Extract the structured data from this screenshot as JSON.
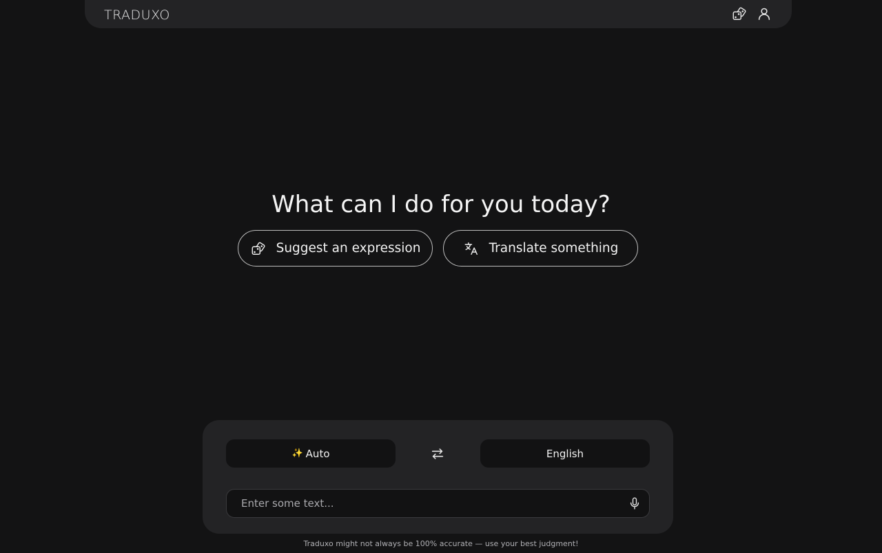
{
  "header": {
    "logo": "TRADUXO",
    "icons": [
      "dice-icon",
      "user-icon"
    ]
  },
  "main": {
    "headline": "What can I do for you today?",
    "actions": [
      {
        "label": "Suggest an expression",
        "icon": "dice-icon"
      },
      {
        "label": "Translate something",
        "icon": "translate-icon"
      }
    ]
  },
  "translator": {
    "source_language": "Auto",
    "source_icon": "✨",
    "target_language": "English",
    "swap_icon": "swap-arrows-icon",
    "input_value": "",
    "input_placeholder": "Enter some text...",
    "mic_icon": "microphone-icon"
  },
  "footer": {
    "disclaimer": "Traduxo might not always be 100% accurate — use your best judgment!"
  },
  "colors": {
    "background": "#131314",
    "surface": "#232325",
    "field": "#121213",
    "text": "#f2f2f2"
  }
}
